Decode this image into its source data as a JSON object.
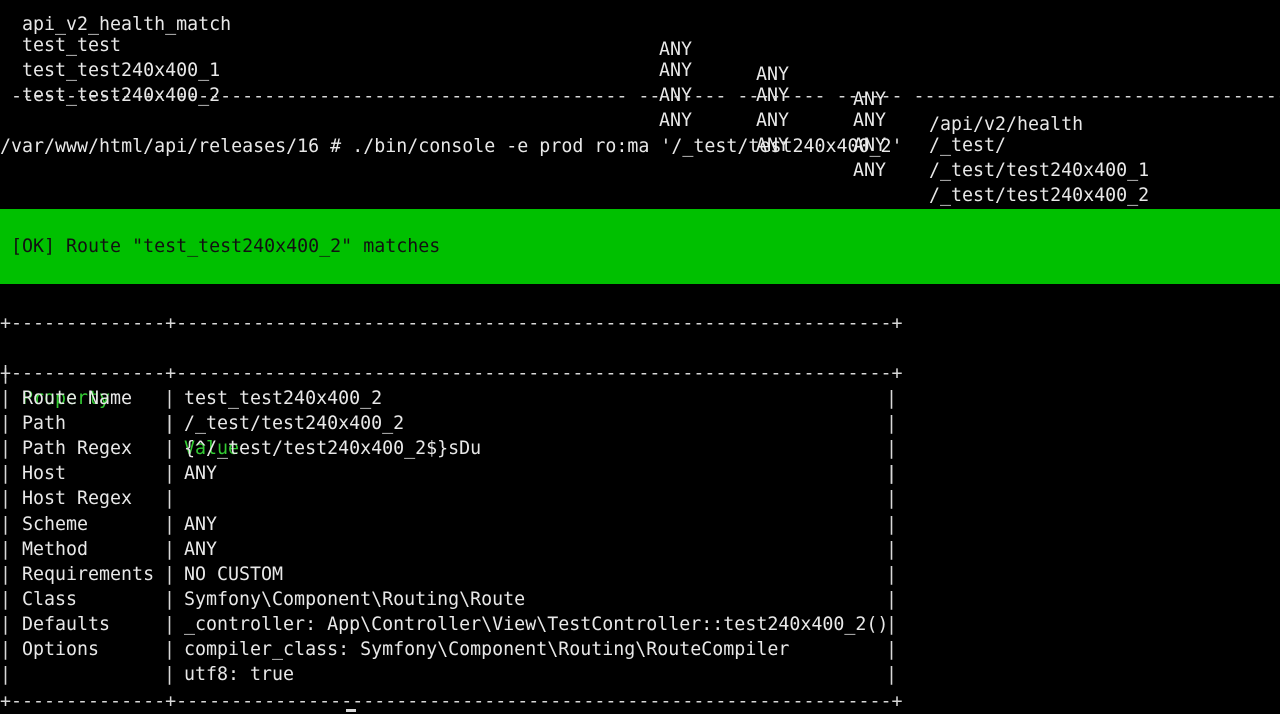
{
  "routes_table": {
    "rows": [
      {
        "name": "api_v2_health_match",
        "method": "ANY",
        "scheme": "ANY",
        "host": "ANY",
        "path": "/api/v2/health"
      },
      {
        "name": "test_test",
        "method": "ANY",
        "scheme": "ANY",
        "host": "ANY",
        "path": "/_test/"
      },
      {
        "name": "test_test240x400_1",
        "method": "ANY",
        "scheme": "ANY",
        "host": "ANY",
        "path": "/_test/test240x400_1"
      },
      {
        "name": "test_test240x400_2",
        "method": "ANY",
        "scheme": "ANY",
        "host": "ANY",
        "path": "/_test/test240x400_2"
      }
    ],
    "separator": " -------------------------------------------------------- -------- -------- ------ -----------------------------------"
  },
  "command": {
    "prompt": "/var/www/html/api/releases/16 # ",
    "text": "./bin/console -e prod ro:ma '/_test/test240x400_2'"
  },
  "ok_banner": {
    "text": "[OK] Route \"test_test240x400_2\" matches",
    "color": "#00c000"
  },
  "details_table": {
    "border": "+--------------+-----------------------------------------------------------------+",
    "headers": {
      "property": "Property",
      "value": "Value"
    },
    "header_color": "#33cc33",
    "rows": [
      {
        "property": "Route Name",
        "value": "test_test240x400_2"
      },
      {
        "property": "Path",
        "value": "/_test/test240x400_2"
      },
      {
        "property": "Path Regex",
        "value": "{^/_test/test240x400_2$}sDu"
      },
      {
        "property": "Host",
        "value": "ANY"
      },
      {
        "property": "Host Regex",
        "value": ""
      },
      {
        "property": "Scheme",
        "value": "ANY"
      },
      {
        "property": "Method",
        "value": "ANY"
      },
      {
        "property": "Requirements",
        "value": "NO CUSTOM"
      },
      {
        "property": "Class",
        "value": "Symfony\\Component\\Routing\\Route"
      },
      {
        "property": "Defaults",
        "value": "_controller: App\\Controller\\View\\TestController::test240x400_2()"
      },
      {
        "property": "Options",
        "value": "compiler_class: Symfony\\Component\\Routing\\RouteCompiler"
      },
      {
        "property": "",
        "value": "utf8: true"
      }
    ]
  }
}
